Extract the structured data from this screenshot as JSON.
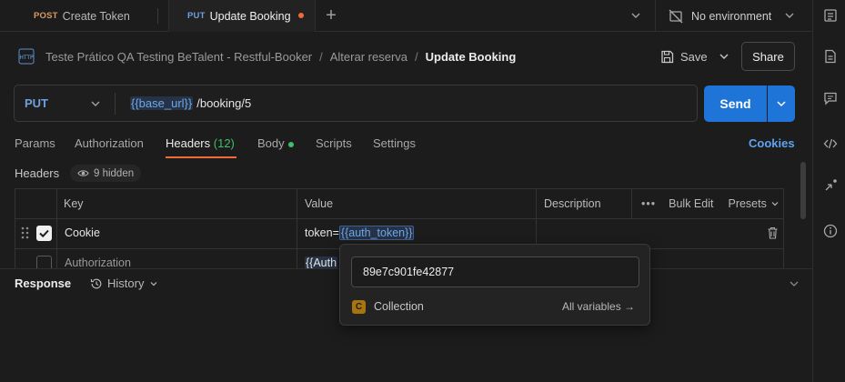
{
  "tabs": [
    {
      "method": "POST",
      "name": "Create Token"
    },
    {
      "method": "PUT",
      "name": "Update Booking"
    }
  ],
  "new_tab": "+",
  "environment": "No environment",
  "breadcrumb": {
    "collection": "Teste Prático QA Testing BeTalent - Restful-Booker",
    "folder": "Alterar reserva",
    "separator": "/",
    "request": "Update Booking"
  },
  "actions": {
    "save": "Save",
    "share": "Share"
  },
  "request": {
    "method": "PUT",
    "url_var": "{{base_url}}",
    "url_path": "/booking/5",
    "send": "Send"
  },
  "request_tabs": {
    "params": "Params",
    "authorization": "Authorization",
    "headers": "Headers",
    "headers_count": "(12)",
    "body": "Body",
    "scripts": "Scripts",
    "settings": "Settings",
    "cookies": "Cookies"
  },
  "headers_section": {
    "title": "Headers",
    "hidden": "9 hidden"
  },
  "table": {
    "columns": {
      "key": "Key",
      "value": "Value",
      "description": "Description"
    },
    "bulk_edit": "Bulk Edit",
    "presets": "Presets",
    "rows": [
      {
        "key": "Cookie",
        "value_prefix": "token=",
        "value_var": "{{auth_token}}",
        "checked": true
      },
      {
        "key": "Authorization",
        "value_var": "{{Auth",
        "checked": false
      }
    ]
  },
  "response": {
    "title": "Response",
    "history": "History"
  },
  "popup": {
    "value": "89e7c901fe42877",
    "scope_badge": "C",
    "scope": "Collection",
    "all_variables": "All variables →"
  },
  "colors": {
    "accent": "#ef6b3a",
    "send": "#1f74d8",
    "put": "#6f9fe0",
    "post": "#d89a5f",
    "count_green": "#3fbf6a"
  }
}
